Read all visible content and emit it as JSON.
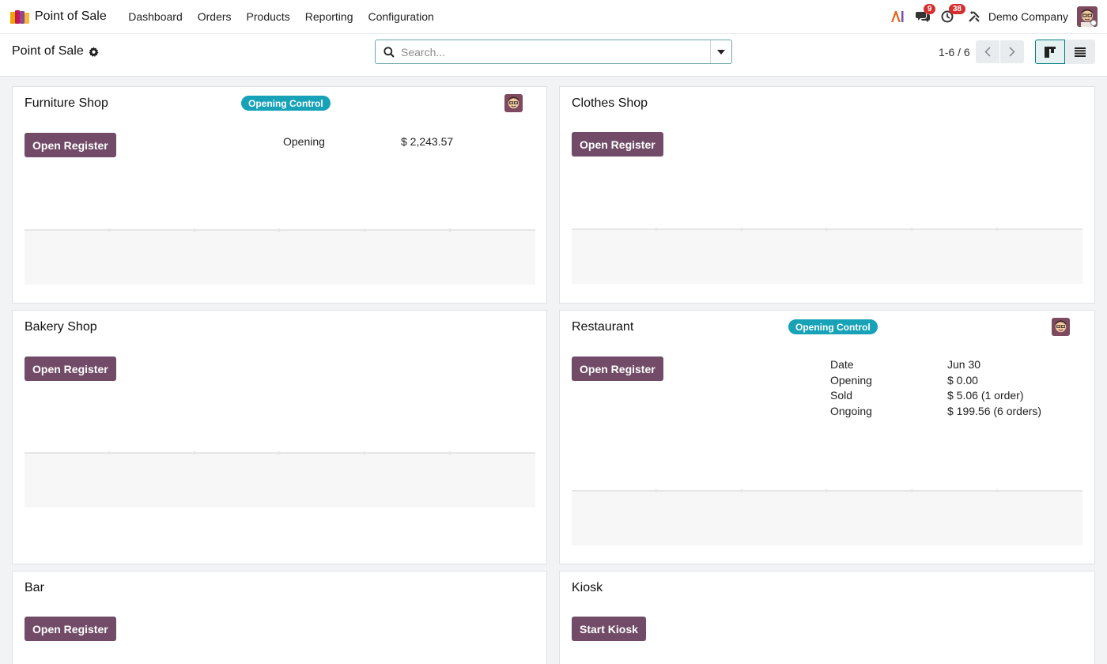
{
  "navbar": {
    "app_name": "Point of Sale",
    "menu": [
      "Dashboard",
      "Orders",
      "Products",
      "Reporting",
      "Configuration"
    ],
    "messages_count": "9",
    "activities_count": "38",
    "company": "Demo Company"
  },
  "control_panel": {
    "breadcrumb": "Point of Sale",
    "search_placeholder": "Search...",
    "pager": "1-6 / 6"
  },
  "colors": {
    "primary_button": "#714b67",
    "status_pill": "#17a2b8",
    "accent": "#017e84",
    "badge": "#d32f2f"
  },
  "cards": {
    "furniture": {
      "title": "Furniture Shop",
      "status": "Opening Control",
      "button": "Open Register",
      "stat_label": "Opening",
      "stat_value": "$ 2,243.57"
    },
    "clothes": {
      "title": "Clothes Shop",
      "button": "Open Register"
    },
    "bakery": {
      "title": "Bakery Shop",
      "button": "Open Register"
    },
    "restaurant": {
      "title": "Restaurant",
      "status": "Opening Control",
      "button": "Open Register",
      "stats": [
        {
          "label": "Date",
          "value": "Jun 30"
        },
        {
          "label": "Opening",
          "value": "$ 0.00"
        },
        {
          "label": "Sold",
          "value": "$ 5.06 (1 order)"
        },
        {
          "label": "Ongoing",
          "value": "$ 199.56 (6 orders)"
        }
      ]
    },
    "bar": {
      "title": "Bar",
      "button": "Open Register"
    },
    "kiosk": {
      "title": "Kiosk",
      "button": "Start Kiosk"
    }
  }
}
